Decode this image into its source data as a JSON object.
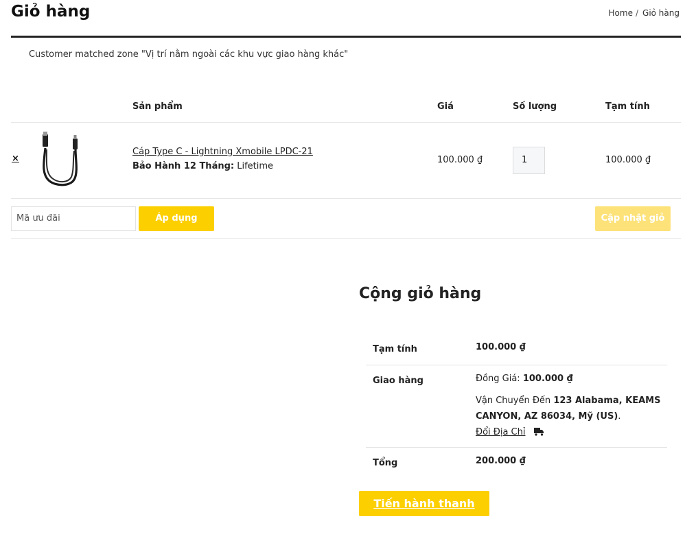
{
  "page": {
    "title": "Giỏ hàng",
    "breadcrumb": [
      "Home",
      "Giỏ hàng"
    ],
    "breadcrumb_separator": "/",
    "notice": "Customer matched zone \"Vị trí nằm ngoài các khu vực giao hàng khác\""
  },
  "cart": {
    "headers": {
      "product": "Sản phẩm",
      "price": "Giá",
      "quantity": "Số lượng",
      "subtotal": "Tạm tính"
    },
    "items": [
      {
        "remove_label": "×",
        "name": "Cáp Type C - Lightning Xmobile LPDC-21",
        "meta_label": "Bảo Hành 12 Tháng:",
        "meta_value": "Lifetime",
        "price": "100.000 ₫",
        "quantity": "1",
        "subtotal": "100.000 ₫",
        "image_icon": "lightning-cable-image"
      }
    ],
    "coupon_placeholder": "Mã ưu đãi",
    "apply_label": "Áp dụng",
    "update_label": "Cập nhật giỏ hàng"
  },
  "totals": {
    "title": "Cộng giỏ hàng",
    "subtotal_label": "Tạm tính",
    "subtotal_value": "100.000 ₫",
    "shipping_label": "Giao hàng",
    "shipping_method_label": "Đồng Giá:",
    "shipping_method_value": "100.000 ₫",
    "ship_to_label": "Vận Chuyển Đến",
    "ship_to_address_line1": "123 Alabama, KEAMS",
    "ship_to_address_line2": "CANYON, AZ 86034, Mỹ (US)",
    "ship_to_address_end": ".",
    "change_address_label": "Đổi Địa Chỉ",
    "total_label": "Tổng",
    "total_value": "200.000 ₫",
    "checkout_label": "Tiến hành thanh toán"
  },
  "colors": {
    "accent": "#fccf00",
    "accent_disabled": "#fde27a",
    "text": "#222222",
    "rule": "#e6e6e6"
  }
}
